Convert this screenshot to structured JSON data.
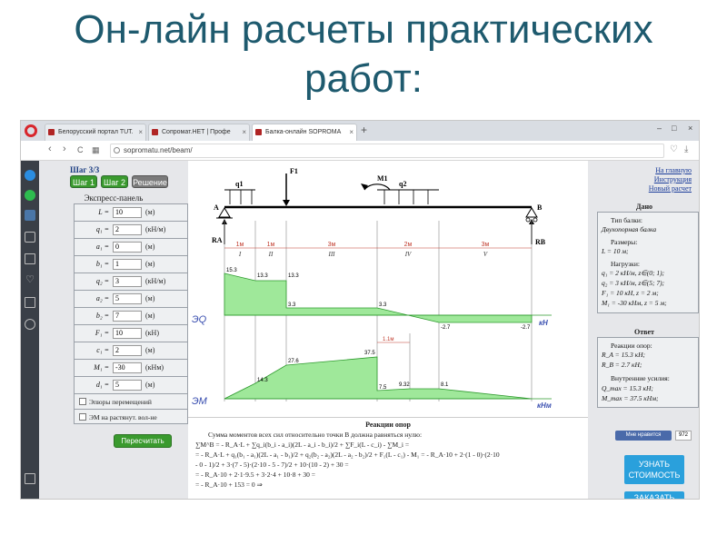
{
  "slide": {
    "title_line1": "Он-лайн расчеты практических",
    "title_line2": "работ:"
  },
  "browser": {
    "tabs": [
      {
        "label": "Белорусский портал TUT."
      },
      {
        "label": "Сопромат.НЕТ | Профе"
      },
      {
        "label": "Балка-онлайн SOPROMA"
      }
    ],
    "new_tab": "+",
    "url": "sopromatu.net/beam/",
    "nav": {
      "back": "‹",
      "forward": "›",
      "reload": "C"
    }
  },
  "left_panel": {
    "step": "Шаг 3/3",
    "btn_step1": "Шаг 1",
    "btn_step2": "Шаг 2",
    "btn_solution": "Решение",
    "header": "Экспресс-панель",
    "params": [
      {
        "label": "L =",
        "value": "10",
        "unit": "(м)"
      },
      {
        "label": "q₁ =",
        "value": "2",
        "unit": "(кН/м)"
      },
      {
        "label": "a₁ =",
        "value": "0",
        "unit": "(м)"
      },
      {
        "label": "b₁ =",
        "value": "1",
        "unit": "(м)"
      },
      {
        "label": "q₂ =",
        "value": "3",
        "unit": "(кН/м)"
      },
      {
        "label": "a₂ =",
        "value": "5",
        "unit": "(м)"
      },
      {
        "label": "b₂ =",
        "value": "7",
        "unit": "(м)"
      },
      {
        "label": "F₁ =",
        "value": "10",
        "unit": "(кН)"
      },
      {
        "label": "c₁ =",
        "value": "2",
        "unit": "(м)"
      },
      {
        "label": "M₁ =",
        "value": "-30",
        "unit": "(кНм)"
      },
      {
        "label": "d₁ =",
        "value": "5",
        "unit": "(м)"
      }
    ],
    "check1": "Эпюры перемещений",
    "check2": "ЭМ на растянут. вол-не",
    "recalc": "Пересчитать"
  },
  "diagram": {
    "load_labels": {
      "q1": "q1",
      "q2": "q2",
      "F1": "F1",
      "M1": "M1",
      "A": "A",
      "B": "B",
      "RA": "RA",
      "RB": "RB"
    },
    "segments": [
      {
        "len": "1м",
        "roman": "I"
      },
      {
        "len": "1м",
        "roman": "II"
      },
      {
        "len": "3м",
        "roman": "III"
      },
      {
        "len": "2м",
        "roman": "IV"
      },
      {
        "len": "3м",
        "roman": "V"
      }
    ],
    "eq_label": "ЭQ",
    "eq_unit": "кН",
    "q_values": [
      "15.3",
      "13.3",
      "13.3",
      "3.3",
      "3.3",
      "-2.7",
      "-2.7"
    ],
    "em_label": "ЭМ",
    "em_unit": "кНм",
    "em_values": [
      "14.3",
      "27.6",
      "37.5",
      "7.5",
      "9.32",
      "8.1"
    ],
    "dim_label": "1.1м"
  },
  "reactions": {
    "title": "Реакции опор",
    "lines": [
      "Сумма моментов всех сил относительно точки B должна равняться нулю:",
      "∑M^B = - R_A·L + ∑q_i(b_i - a_i)(2L - a_i - b_i)/2 + ∑F_i(L - c_i) - ∑M_i =",
      "= - R_A·L + q₁(b₁ - a₁)(2L - a₁ - b₁)/2 + q₂(b₂ - a₂)(2L - a₂ - b₂)/2 + F₁(L - c₁) - M₁ = - R_A·10 + 2·(1 - 0)·(2·10",
      "- 0 - 1)/2 + 3·(7 - 5)·(2·10 - 5 - 7)/2 + 10·(10 - 2) + 30 =",
      "= - R_A·10 + 2·1·9.5 + 3·2·4 + 10·8 + 30 =",
      "= - R_A·10 + 153 = 0 ⇒"
    ]
  },
  "right_panel": {
    "link_home": "На главную",
    "link_help": "Инструкция",
    "link_new": "Новый расчет",
    "given_title": "Дано",
    "given": {
      "type_head": "Тип балки:",
      "type_val": "Двухопорная балка",
      "size_head": "Размеры:",
      "size_val": "L = 10 м;",
      "loads_head": "Нагрузки:",
      "load1": "q₁ = 2 кН/м, z∈(0; 1);",
      "load2": "q₂ = 3 кН/м, z∈(5; 7);",
      "load3": "F₁ = 10 кН, z = 2 м;",
      "load4": "M₁ = -30 кНм, z = 5 м;"
    },
    "answer_title": "Ответ",
    "answer": {
      "react_head": "Реакции опор:",
      "ra": "R_A = 15.3 кН;",
      "rb": "R_B = 2.7 кН;",
      "forces_head": "Внутренние усилия:",
      "qmax": "Q_max = 15.3 кН;",
      "mmax": "M_max = 37.5 кНм;"
    },
    "like": "Мне нравится",
    "like_count": "972",
    "cost_line1": "УЗНАТЬ",
    "cost_line2": "СТОИМОСТЬ",
    "cost2": "ЗАКАЗАТЬ"
  },
  "colors": {
    "title": "#1e5a6e",
    "step_green": "#3a9a2e",
    "step_gray": "#7a7a7a",
    "epure_fill": "#9fe89a",
    "epure_label": "#3a4fb0",
    "cost_blue": "#2aa0dc",
    "opera_red": "#d8262c"
  }
}
